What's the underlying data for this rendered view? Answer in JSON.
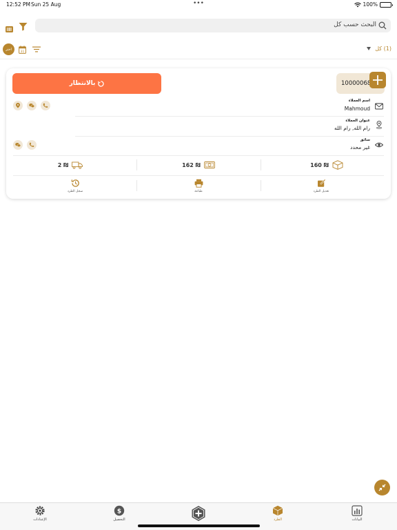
{
  "status_bar": {
    "time": "12:52 PM",
    "date": "Sun 25 Aug",
    "battery": "100%"
  },
  "search": {
    "placeholder": "البحث حسب كل"
  },
  "toolbar": {
    "select_all_label": "اختر",
    "count_label": "(1) كل"
  },
  "order": {
    "status_label": "بالانتظار",
    "number": "10000068",
    "customer_name_label": "اسم العملاء",
    "customer_name": "Mahmoud",
    "customer_address_label": "عنوان العملاء",
    "customer_address": "رام الله, رام الله",
    "driver_label": "سائق",
    "driver_value": "غير محدد",
    "stats": {
      "price": "160 ₪",
      "amount": "162 ₪",
      "delivery": "2 ₪"
    },
    "actions": {
      "edit": "تعديل الطرد",
      "print": "طباعة",
      "history": "سجل الطرد"
    }
  },
  "tabs": {
    "stats": "البيانات",
    "parcels": "الطرد",
    "collection": "التحصيل",
    "settings": "الإعدادات"
  },
  "colors": {
    "accent": "#b8862e",
    "status_orange": "#fd7444",
    "badge_bg": "#f1e7d6"
  }
}
